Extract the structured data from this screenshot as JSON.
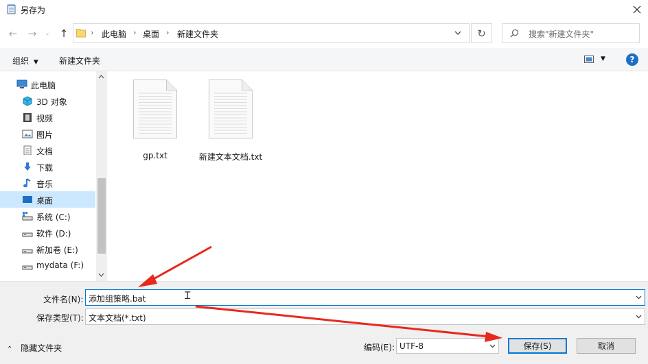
{
  "window": {
    "title": "另存为"
  },
  "address": {
    "crumbs": [
      "此电脑",
      "桌面",
      "新建文件夹"
    ],
    "search_placeholder": "搜索\"新建文件夹\""
  },
  "toolbar": {
    "organize_label": "组织",
    "new_folder_label": "新建文件夹"
  },
  "sidebar": {
    "items": [
      {
        "label": "此电脑",
        "icon": "computer-icon"
      },
      {
        "label": "3D 对象",
        "icon": "cube-icon"
      },
      {
        "label": "视频",
        "icon": "video-icon"
      },
      {
        "label": "图片",
        "icon": "picture-icon"
      },
      {
        "label": "文档",
        "icon": "document-icon"
      },
      {
        "label": "下载",
        "icon": "download-icon"
      },
      {
        "label": "音乐",
        "icon": "music-icon"
      },
      {
        "label": "桌面",
        "icon": "desktop-icon",
        "selected": true
      },
      {
        "label": "系统 (C:)",
        "icon": "system-drive-icon"
      },
      {
        "label": "软件 (D:)",
        "icon": "drive-icon"
      },
      {
        "label": "新加卷 (E:)",
        "icon": "drive-icon"
      },
      {
        "label": "mydata (F:)",
        "icon": "drive-icon"
      }
    ]
  },
  "files": [
    {
      "name": "gp.txt",
      "icon": "text-file-icon"
    },
    {
      "name": "新建文本文档.txt",
      "icon": "text-file-icon"
    }
  ],
  "form": {
    "filename_label": "文件名(N):",
    "filename_value": "添加组策略.bat",
    "filetype_label": "保存类型(T):",
    "filetype_value": "文本文档(*.txt)",
    "encoding_label": "编码(E):",
    "encoding_value": "UTF-8"
  },
  "footer": {
    "hide_folders_label": "隐藏文件夹",
    "save_label": "保存(S)",
    "cancel_label": "取消"
  },
  "colors": {
    "accent": "#0078d7",
    "selected_bg": "#cce8ff",
    "arrow": "#e8281c"
  }
}
